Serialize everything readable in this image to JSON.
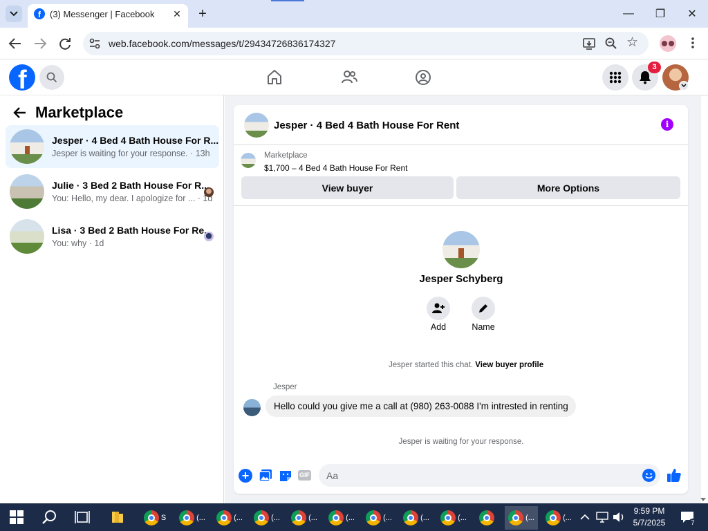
{
  "browser": {
    "tab_title": "(3) Messenger | Facebook",
    "url": "web.facebook.com/messages/t/29434726836174327"
  },
  "fb": {
    "notification_count": "3"
  },
  "left": {
    "title": "Marketplace",
    "conversations": [
      {
        "name": "Jesper · 4 Bed 4 Bath House For R...",
        "preview": "Jesper is waiting for your response. · 13h"
      },
      {
        "name": "Julie · 3 Bed 2 Bath House For R...",
        "preview": "You: Hello, my dear. I apologize for ... · 1d"
      },
      {
        "name": "Lisa · 3 Bed 2 Bath House For Re...",
        "preview": "You: why · 1d"
      }
    ]
  },
  "chat": {
    "header_title": "Jesper · 4 Bed 4 Bath House For Rent",
    "listing_source": "Marketplace",
    "listing_title": "$1,700 – 4 Bed 4 Bath House For Rent",
    "view_buyer_label": "View buyer",
    "more_options_label": "More Options",
    "profile_name": "Jesper Schyberg",
    "add_label": "Add",
    "name_label": "Name",
    "started_text": "Jesper started this chat.",
    "view_profile_link": "View buyer profile",
    "sender_name": "Jesper",
    "message": "Hello could you give me a call at (980) 263-0088 I'm intrested in renting",
    "waiting_text": "Jesper is waiting for your response.",
    "input_placeholder": "Aa",
    "gif_label": "GIF"
  },
  "taskbar": {
    "app_labels": [
      "S",
      "(...",
      "(...",
      "(...",
      "(...",
      "(...",
      "(...",
      "(...",
      "(...",
      "(..."
    ],
    "time": "9:59 PM",
    "date": "5/7/2025",
    "notif_count": "7"
  },
  "colors": {
    "fb_blue": "#0866ff",
    "purple_info": "#a100ff",
    "red_badge": "#e41e3f"
  }
}
